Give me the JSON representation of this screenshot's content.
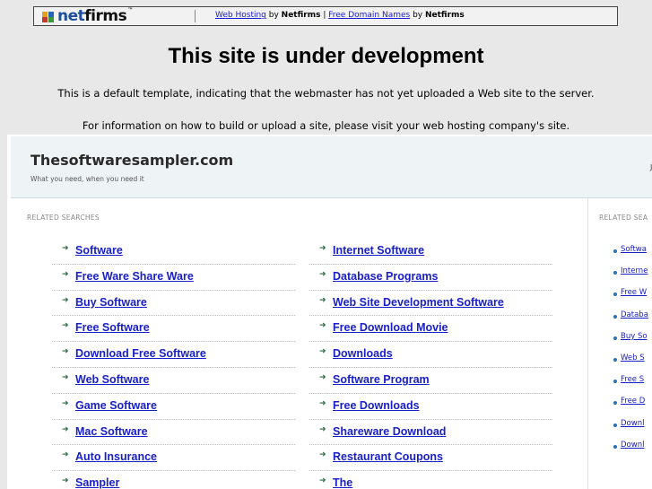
{
  "topbar": {
    "logo_text_net": "net",
    "logo_text_firms": "firms",
    "logo_tm": "™",
    "link1": "Web Hosting",
    "by1": " by ",
    "brand1": "Netfirms",
    "separator": " | ",
    "link2": "Free Domain Names",
    "by2": " by ",
    "brand2": "Netfirms"
  },
  "hero": {
    "title": "This site is under development",
    "line1": "This is a default template, indicating that the webmaster has not yet uploaded a Web site to the server.",
    "line2": "For information on how to build or upload a site, please visit your web hosting company's site."
  },
  "site": {
    "title": "Thesoftwaresampler.com",
    "tagline": "What you need, when you need it",
    "right_fragment": "J"
  },
  "main": {
    "related_label": "RELATED SEARCHES",
    "arrow_glyph": "➜",
    "col1": [
      "Software",
      "Free Ware Share Ware",
      "Buy Software",
      "Free Software",
      "Download Free Software",
      "Web Software",
      "Game Software",
      "Mac Software",
      "Auto Insurance",
      "Sampler"
    ],
    "col2": [
      "Internet Software",
      "Database Programs",
      "Web Site Development Software",
      "Free Download Movie",
      "Downloads",
      "Software Program",
      "Free Downloads",
      "Shareware Download",
      "Restaurant Coupons",
      "The"
    ]
  },
  "side": {
    "related_label": "RELATED SEA",
    "items": [
      "Softwa",
      "Interne",
      "Free W",
      "Databa",
      "Buy So",
      "Web S",
      "Free S",
      "Free D",
      "Downl",
      "Downl"
    ]
  },
  "colors": {
    "link": "#1a20c8",
    "arrow": "#2b6a45",
    "header_bg": "#eef4f6"
  }
}
